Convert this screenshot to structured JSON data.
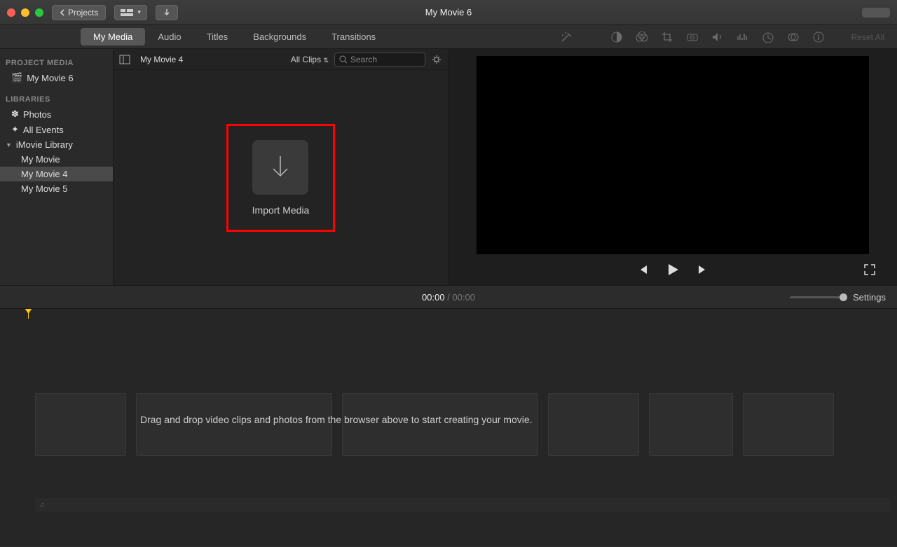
{
  "title": "My Movie 6",
  "toolbar": {
    "back": "Projects"
  },
  "tabs": [
    "My Media",
    "Audio",
    "Titles",
    "Backgrounds",
    "Transitions"
  ],
  "active_tab": 0,
  "reset_label": "Reset All",
  "sidebar": {
    "section1": "PROJECT MEDIA",
    "project": "My Movie 6",
    "section2": "LIBRARIES",
    "photos": "Photos",
    "all_events": "All Events",
    "library": "iMovie Library",
    "items": [
      "My Movie",
      "My Movie 4",
      "My Movie 5"
    ],
    "selected": 1
  },
  "browser": {
    "event_name": "My Movie 4",
    "filter": "All Clips",
    "search_placeholder": "Search",
    "import_label": "Import Media"
  },
  "timecode": {
    "current": "00:00",
    "sep": " / ",
    "duration": "00:00"
  },
  "settings_label": "Settings",
  "timeline_hint": "Drag and drop video clips and photos from the browser above to start creating your movie."
}
